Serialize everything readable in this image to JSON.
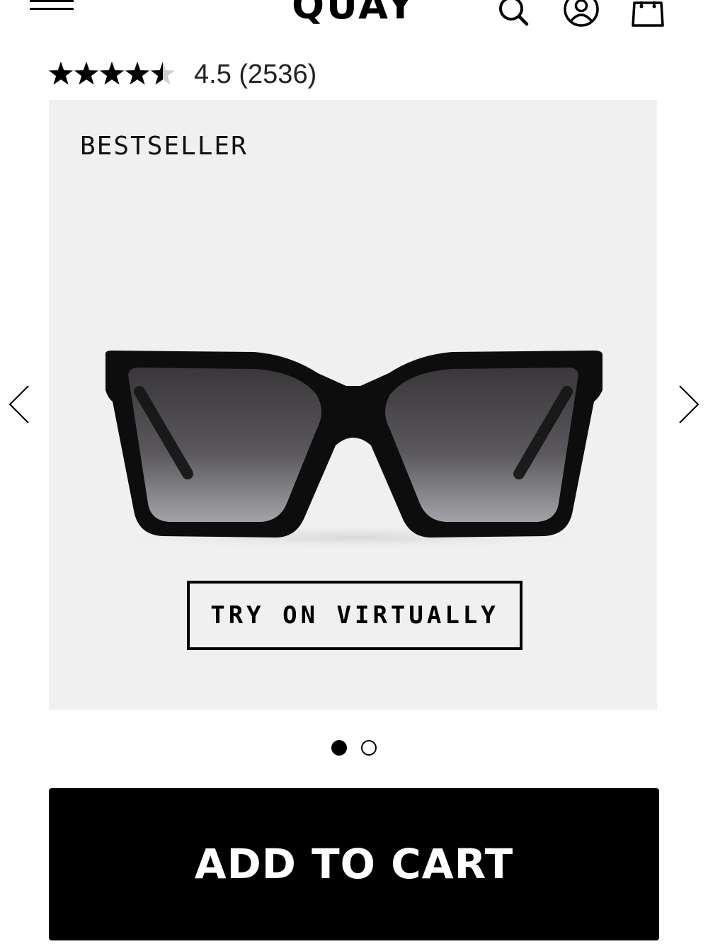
{
  "header": {
    "logo_text": "QUAY",
    "icons": [
      "menu-icon",
      "search-icon",
      "account-icon",
      "shopping-bag-icon"
    ]
  },
  "rating": {
    "value": 4.5,
    "max": 5,
    "text": "4.5 (2536)"
  },
  "product": {
    "badge": "BESTSELLER",
    "try_on_label": "TRY ON VIRTUALLY",
    "image_icon": "sunglasses-image",
    "carousel": {
      "current_slide": 1,
      "total_slides": 2,
      "prev_icon": "chevron-left-icon",
      "next_icon": "chevron-right-icon"
    }
  },
  "cta": {
    "add_to_cart_label": "ADD TO CART"
  },
  "colors": {
    "background": "#ffffff",
    "panel": "#f0f0f0",
    "primary": "#000000",
    "button_text": "#ffffff"
  }
}
